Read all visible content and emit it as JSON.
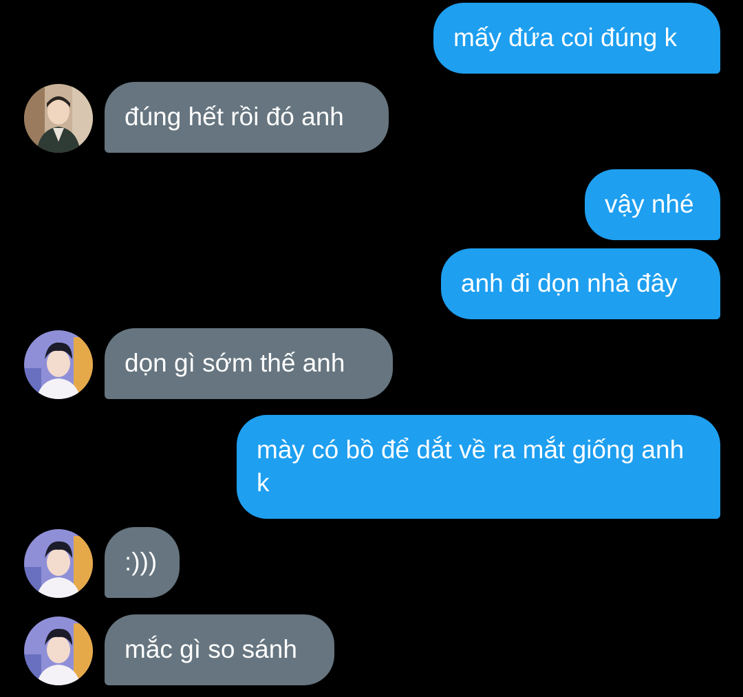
{
  "colors": {
    "background": "#000000",
    "outgoing_bubble": "#1e9ff0",
    "incoming_bubble": "#66757f",
    "text": "#ffffff"
  },
  "messages": [
    {
      "direction": "outgoing",
      "text": "mấy đứa coi đúng k"
    },
    {
      "direction": "incoming",
      "text": "đúng hết rồi đó anh",
      "avatar": "avatar-contact-photo-1"
    },
    {
      "direction": "outgoing",
      "text": "vậy nhé"
    },
    {
      "direction": "outgoing",
      "text": "anh đi dọn nhà đây"
    },
    {
      "direction": "incoming",
      "text": "dọn gì sớm thế anh",
      "avatar": "avatar-contact-photo-2"
    },
    {
      "direction": "outgoing",
      "text": "mày có bồ để dắt về ra mắt giống anh k"
    },
    {
      "direction": "incoming",
      "text": ":)))",
      "avatar": "avatar-contact-photo-2"
    },
    {
      "direction": "incoming",
      "text": "mắc gì so sánh",
      "avatar": "avatar-contact-photo-2"
    }
  ]
}
